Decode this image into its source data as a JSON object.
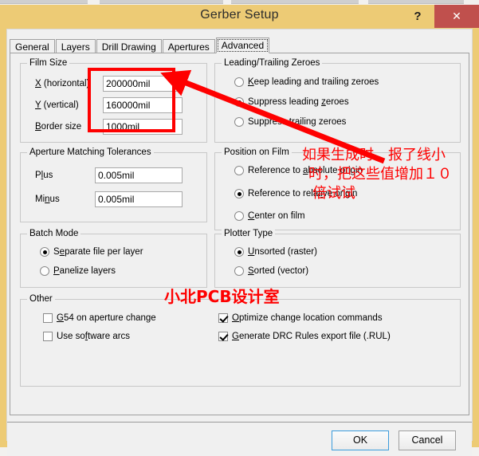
{
  "window": {
    "title": "Gerber Setup",
    "help_label": "?",
    "close_label": "✕"
  },
  "tabs": [
    {
      "label": "General",
      "selected": false
    },
    {
      "label": "Layers",
      "selected": false
    },
    {
      "label": "Drill Drawing",
      "selected": false
    },
    {
      "label": "Apertures",
      "selected": false
    },
    {
      "label": "Advanced",
      "selected": true
    }
  ],
  "film_size": {
    "title": "Film Size",
    "fields": [
      {
        "label_pre": "",
        "label_key": "X",
        "label_post": " (horizontal)",
        "value": "200000mil"
      },
      {
        "label_pre": "",
        "label_key": "Y",
        "label_post": " (vertical)",
        "value": "160000mil"
      },
      {
        "label_pre": "",
        "label_key": "B",
        "label_post": "order size",
        "value": "1000mil"
      }
    ]
  },
  "aperture_tolerances": {
    "title": "Aperture Matching Tolerances",
    "fields": [
      {
        "label_pre": "P",
        "label_key": "l",
        "label_post": "us",
        "value": "0.005mil"
      },
      {
        "label_pre": "Mi",
        "label_key": "n",
        "label_post": "us",
        "value": "0.005mil"
      }
    ]
  },
  "batch_mode": {
    "title": "Batch Mode",
    "options": [
      {
        "pre": "S",
        "key": "e",
        "post": "parate file per layer",
        "checked": true
      },
      {
        "pre": "",
        "key": "P",
        "post": "anelize layers",
        "checked": false
      }
    ]
  },
  "leading_trailing_zeroes": {
    "title": "Leading/Trailing Zeroes",
    "options": [
      {
        "pre": "",
        "key": "K",
        "post": "eep leading and trailing zeroes",
        "checked": false
      },
      {
        "pre": "Suppress leading ",
        "key": "z",
        "post": "eroes",
        "checked": true
      },
      {
        "pre": "Suppress ",
        "key": "t",
        "post": "railing zeroes",
        "checked": false
      }
    ]
  },
  "position_on_film": {
    "title": "Position on Film",
    "options": [
      {
        "pre": "Reference to ",
        "key": "a",
        "post": "bsolute origin",
        "checked": false
      },
      {
        "pre": "Reference to relat",
        "key": "i",
        "post": "ve origin",
        "checked": true
      },
      {
        "pre": "",
        "key": "C",
        "post": "enter on film",
        "checked": false
      }
    ]
  },
  "plotter_type": {
    "title": "Plotter Type",
    "options": [
      {
        "pre": "",
        "key": "U",
        "post": "nsorted (raster)",
        "checked": true
      },
      {
        "pre": "",
        "key": "S",
        "post": "orted (vector)",
        "checked": false
      }
    ]
  },
  "other": {
    "title": "Other",
    "left_options": [
      {
        "pre": "",
        "key": "G",
        "post": "54 on aperture change",
        "checked": false
      },
      {
        "pre": "Use so",
        "key": "f",
        "post": "tware arcs",
        "checked": false
      }
    ],
    "right_options": [
      {
        "pre": "",
        "key": "O",
        "post": "ptimize change location commands",
        "checked": true
      },
      {
        "pre": "",
        "key": "G",
        "post": "enerate DRC Rules export file (.RUL)",
        "checked": true
      }
    ]
  },
  "footer": {
    "ok_label": "OK",
    "cancel_label": "Cancel"
  },
  "annotations": {
    "note_line_1": "如果生成时，报了线小",
    "note_line_2": "时，把这些值增加１０",
    "note_line_3": "倍试试",
    "watermark": "小北PCB设计室",
    "color": "#fe0000"
  }
}
